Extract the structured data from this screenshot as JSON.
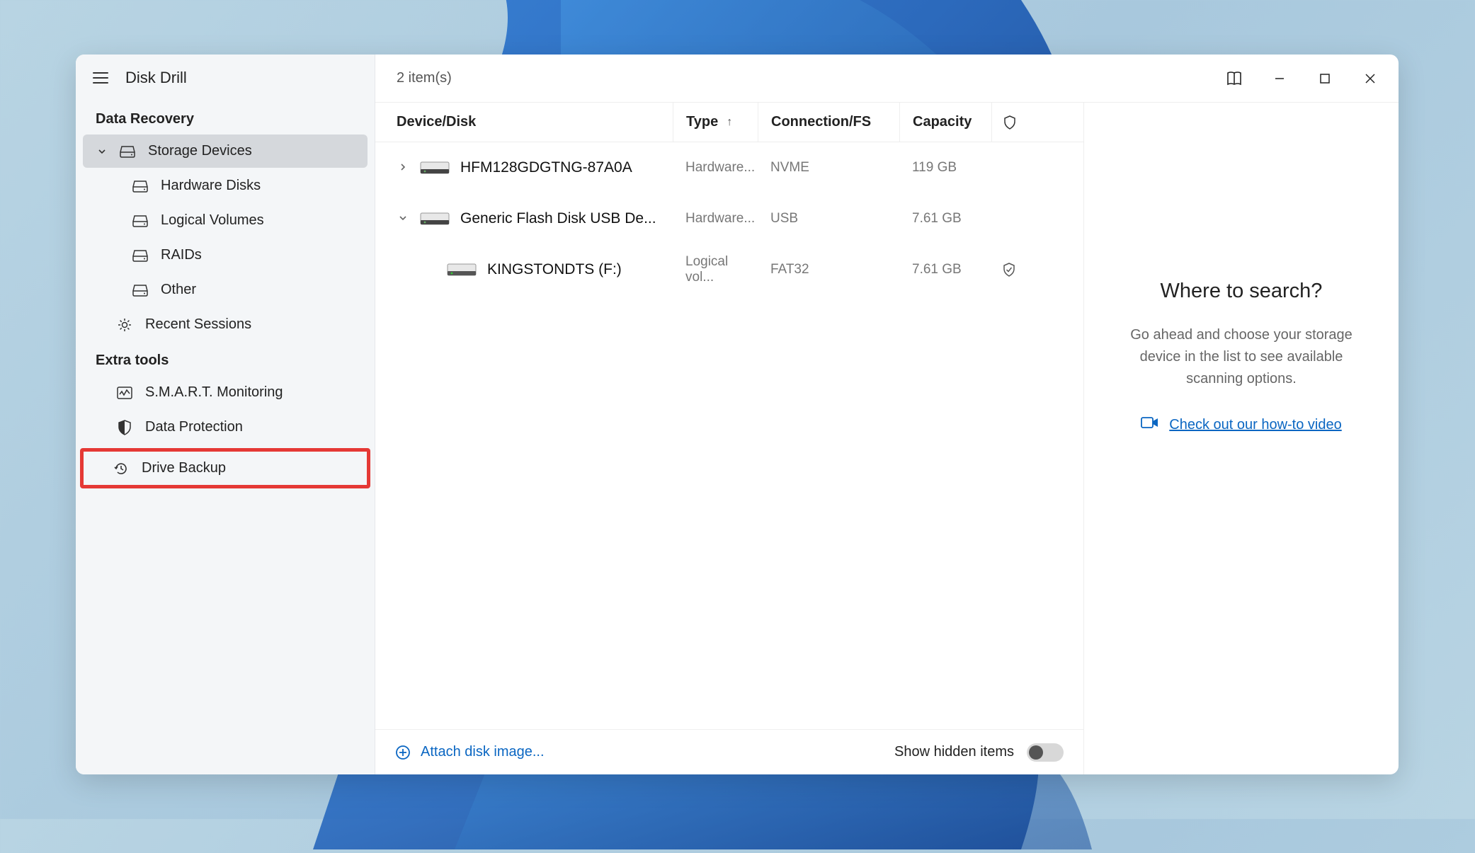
{
  "app": {
    "title": "Disk Drill"
  },
  "titlebar": {
    "item_count": "2 item(s)"
  },
  "sidebar": {
    "section1": "Data Recovery",
    "storage_devices": "Storage Devices",
    "hardware_disks": "Hardware Disks",
    "logical_volumes": "Logical Volumes",
    "raids": "RAIDs",
    "other": "Other",
    "recent_sessions": "Recent Sessions",
    "section2": "Extra tools",
    "smart": "S.M.A.R.T. Monitoring",
    "data_protection": "Data Protection",
    "drive_backup": "Drive Backup"
  },
  "table": {
    "headers": {
      "device": "Device/Disk",
      "type": "Type",
      "connection": "Connection/FS",
      "capacity": "Capacity"
    },
    "rows": [
      {
        "expand": "closed",
        "name": "HFM128GDGTNG-87A0A",
        "type": "Hardware...",
        "conn": "NVME",
        "cap": "119 GB",
        "shield": false,
        "indent": 0,
        "icon": "drive-dark"
      },
      {
        "expand": "open",
        "name": "Generic Flash Disk USB De...",
        "type": "Hardware...",
        "conn": "USB",
        "cap": "7.61 GB",
        "shield": false,
        "indent": 0,
        "icon": "drive-dark"
      },
      {
        "expand": "none",
        "name": "KINGSTONDTS (F:)",
        "type": "Logical vol...",
        "conn": "FAT32",
        "cap": "7.61 GB",
        "shield": true,
        "indent": 1,
        "icon": "drive-green"
      }
    ]
  },
  "right": {
    "title": "Where to search?",
    "desc": "Go ahead and choose your storage device in the list to see available scanning options.",
    "video_link": "Check out our how-to video"
  },
  "bottom": {
    "attach": "Attach disk image...",
    "hidden": "Show hidden items"
  }
}
